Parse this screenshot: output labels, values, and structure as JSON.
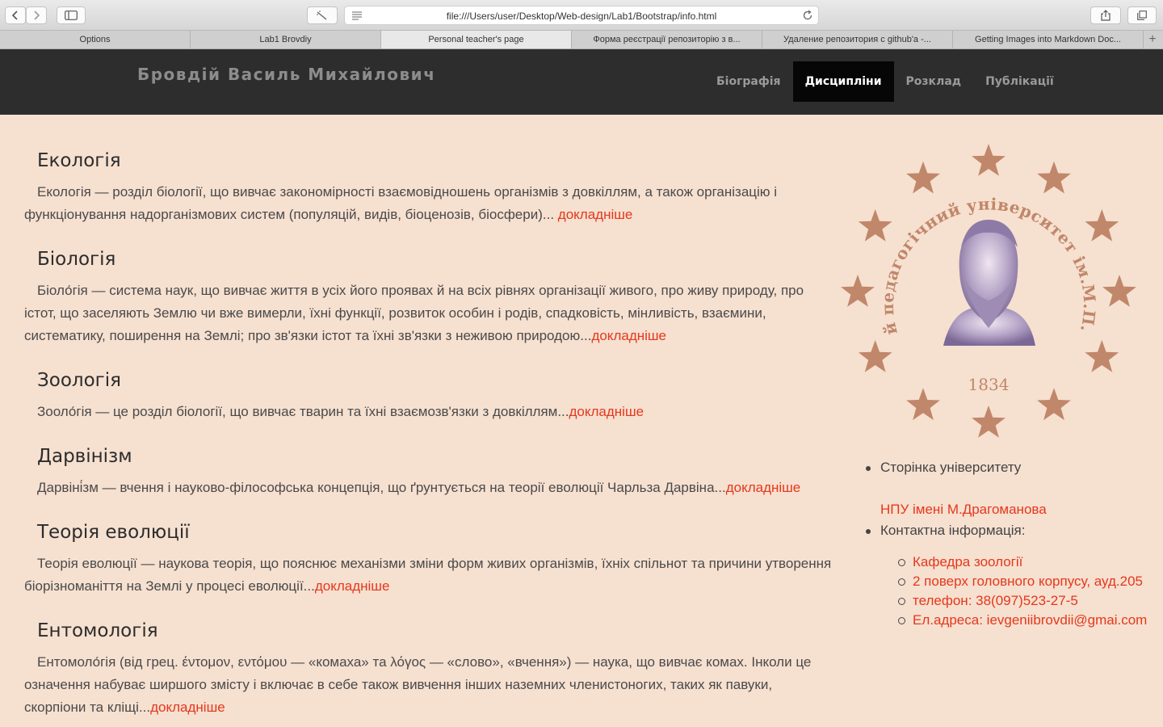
{
  "browser": {
    "url": "file:///Users/user/Desktop/Web-design/Lab1/Bootstrap/info.html",
    "tabs": [
      {
        "label": "Options"
      },
      {
        "label": "Lab1 Brovdiy"
      },
      {
        "label": "Personal teacher's page"
      },
      {
        "label": "Форма реєстрації репозиторію з в..."
      },
      {
        "label": "Удаление репозитория с github'а -..."
      },
      {
        "label": "Getting Images into Markdown Doc..."
      }
    ],
    "active_tab": 2
  },
  "header": {
    "brand": "Бровдій Василь Михайлович",
    "nav": [
      {
        "label": "Біографія"
      },
      {
        "label": "Дисципліни"
      },
      {
        "label": "Розклад"
      },
      {
        "label": "Публікації"
      }
    ],
    "active_nav": 1
  },
  "sections": [
    {
      "title": "Екологія",
      "text": "Екологія — розділ біології, що вивчає закономірності взаємовідношень організмів з довкіллям, а також організацію і функціонування надорганізмових систем (популяцій, видів, біоценозів, біосфери)...",
      "link": " докладніше"
    },
    {
      "title": "Біологія",
      "text": "Біоло́гія — система наук, що вивчає життя в усіх його проявах й на всіх рівнях організації живого, про живу природу, про істот, що заселяють Землю чи вже вимерли, їхні функції, розвиток особин і родів, спадковість, мінливість, взаємини, систематику, поширення на Землі; про зв'язки істот та їхні зв'язки з неживою природою...",
      "link": "докладніше"
    },
    {
      "title": "Зоологія",
      "text": "Зооло́гія — це розділ біології, що вивчає тварин та їхні взаємозв'язки з довкіллям...",
      "link": "докладніше"
    },
    {
      "title": "Дарвінізм",
      "text": "Дарвіні́зм — вчення і науково-філософська концепція, що ґрунтується на теорії еволюції Чарльза Дарвіна...",
      "link": "докладніше"
    },
    {
      "title": "Теорія еволюції",
      "text": "Теорія еволюції — наукова теорія, що пояснює механізми зміни форм живих організмів, їхніх спільнот та причини утворення біорізноманіття на Землі у процесі еволюції...",
      "link": "докладніше"
    },
    {
      "title": "Ентомологія",
      "text": "Ентомоло́гія (від грец. έντομον, εντόμου — «комаха» та λόγος — «слово», «вчення») — наука, що вивчає комах. Інколи це означення набуває ширшого змісту і включає в себе також вивчення інших наземних членистоногих, таких як павуки, скорпіони та кліщі...",
      "link": "докладніше"
    }
  ],
  "emblem": {
    "arc_text": "Національний педагогічний університет ім.М.П.Драгоманова",
    "year": "1834",
    "color": "#c0876a"
  },
  "sidebar": {
    "university_label": "Сторінка університету",
    "university_link": "НПУ імені М.Драгоманова",
    "contacts_label": "Контактна інформація:",
    "contacts": [
      "Кафедра зоології",
      "2 поверх головного корпусу, ауд.205",
      "телефон: 38(097)523-27-5",
      "Ел.адреса: ievgeniibrovdii@gmai.com"
    ]
  },
  "colors": {
    "background": "#f6e0d0",
    "navbar": "#2d2d2d",
    "link": "#e5381c"
  }
}
